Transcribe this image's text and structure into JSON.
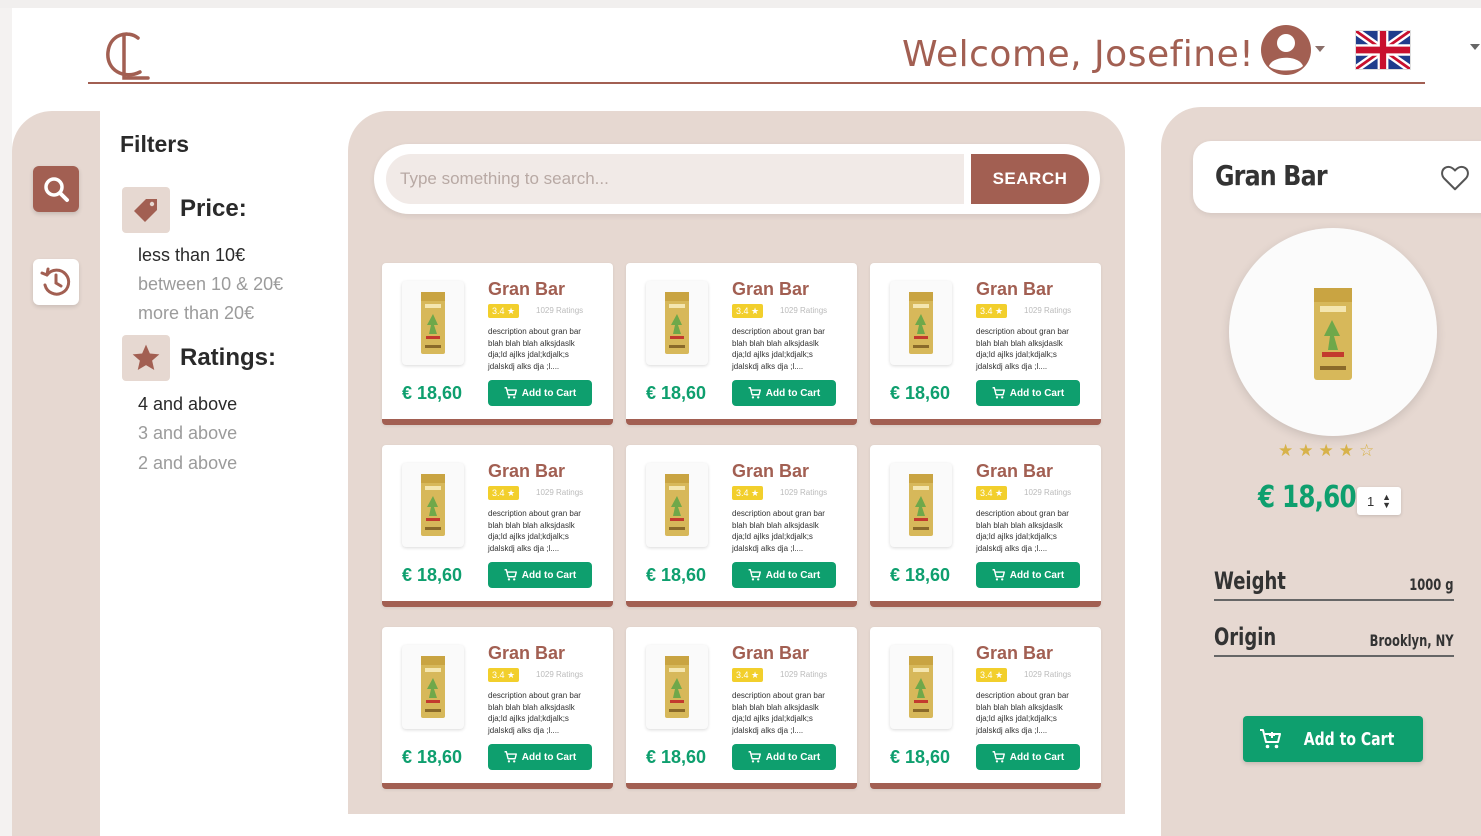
{
  "header": {
    "welcome": "Welcome, Josefine!"
  },
  "search": {
    "placeholder": "Type something to search...",
    "button_label": "SEARCH"
  },
  "filters": {
    "title": "Filters",
    "price": {
      "title": "Price:",
      "options": [
        "less than 10€",
        "between 10 & 20€",
        "more than 20€"
      ],
      "active_index": 0
    },
    "ratings": {
      "title": "Ratings:",
      "options": [
        "4 and above",
        "3 and above",
        "2 and above"
      ],
      "active_index": 0
    }
  },
  "product_card": {
    "name": "Gran Bar",
    "rating": "3.4 ★",
    "ratings_count": "1029 Ratings",
    "description": "description about gran bar blah blah blah alksjdaslk dja;ld ajlks jdal;kdjalk;s jdalskdj alks dja ;l....",
    "price": "€ 18,60",
    "button_label": "Add to Cart"
  },
  "grid": {
    "rows": 3,
    "cols": 3
  },
  "detail": {
    "title": "Gran Bar",
    "stars_full": 4,
    "stars_half": 0,
    "stars_total": 5,
    "price": "€ 18,60",
    "quantity": "1",
    "specs": [
      {
        "label": "Weight",
        "value": "1000 g"
      },
      {
        "label": "Origin",
        "value": "Brooklyn, NY"
      }
    ],
    "button_label": "Add to Cart"
  },
  "colors": {
    "brand": "#a25f52",
    "accent_green": "#0e9f6e",
    "panel_bg": "#e6d8d1",
    "rating_yellow": "#f2cf2c"
  }
}
